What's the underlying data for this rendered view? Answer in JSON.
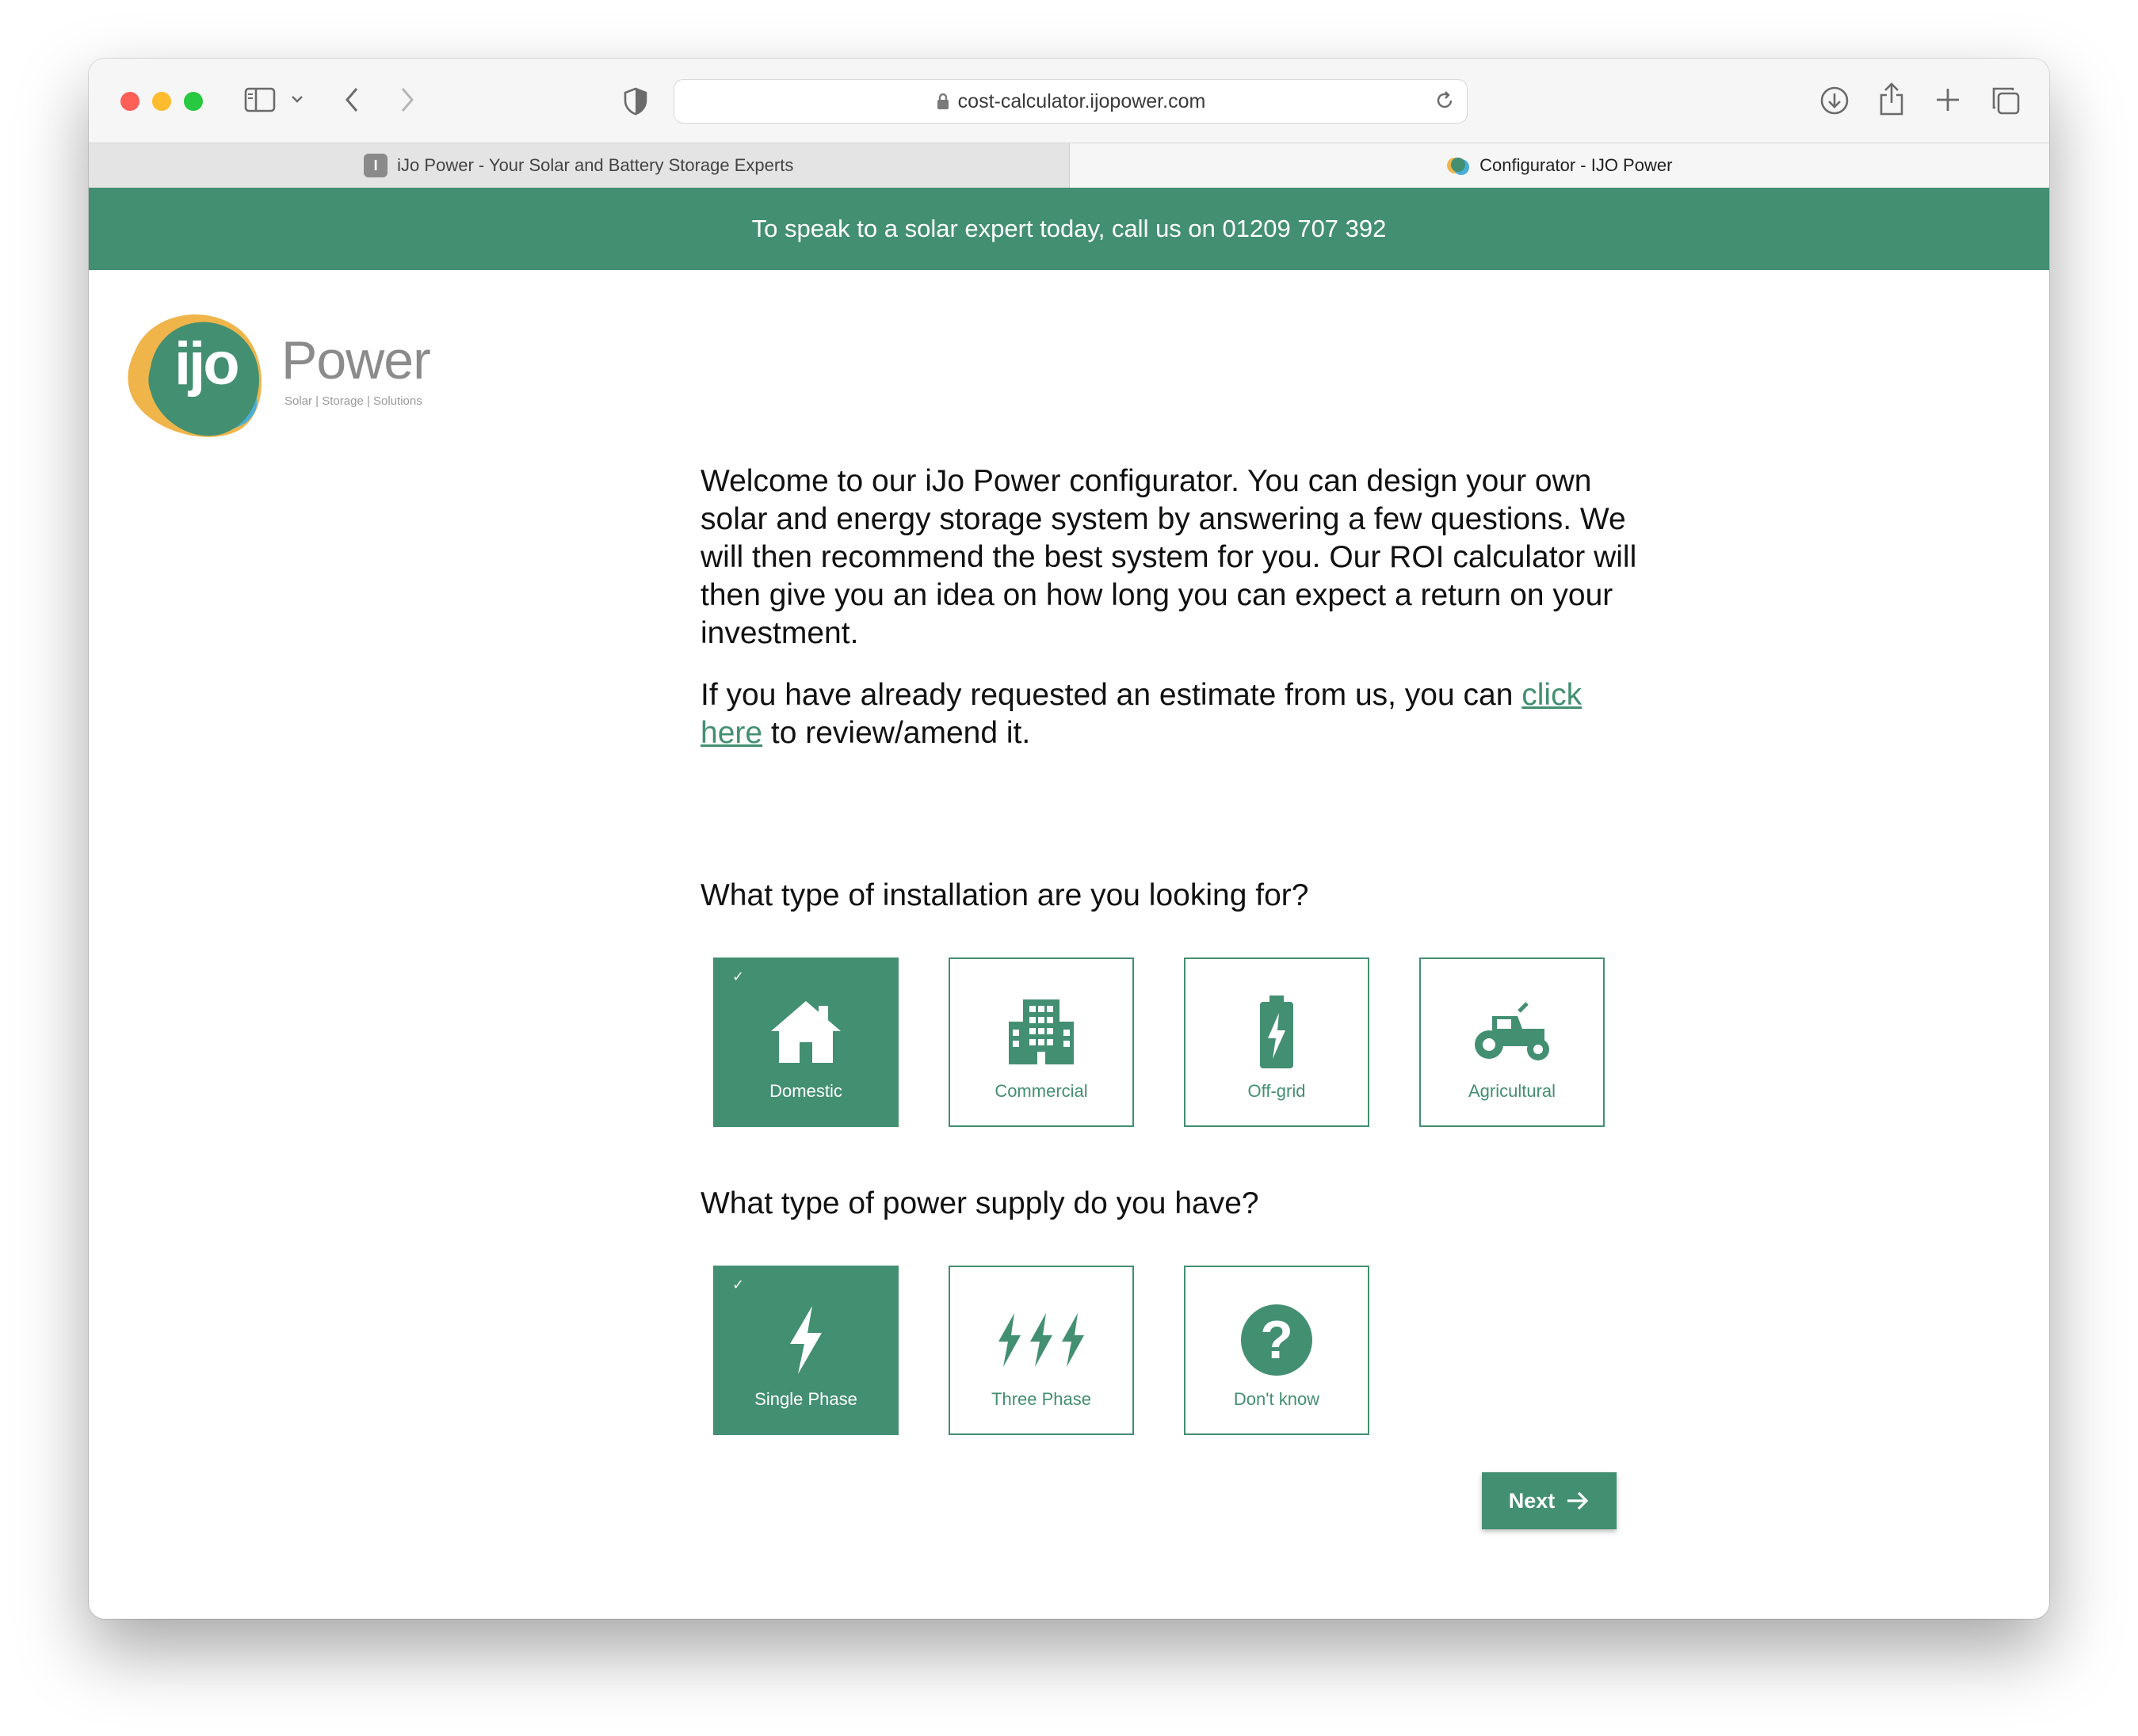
{
  "browser": {
    "url": "cost-calculator.ijopower.com",
    "tabs": [
      {
        "title": "iJo Power - Your Solar and Battery Storage Experts",
        "favicon_letter": "I"
      },
      {
        "title": "Configurator - IJO Power",
        "favicon_letter": "ijo"
      }
    ]
  },
  "banner": {
    "text": "To speak to a solar expert today, call us on 01209 707 392"
  },
  "logo": {
    "mark": "ijo",
    "wordmark": "Power",
    "tagline": "Solar | Storage | Solutions"
  },
  "intro": {
    "paragraph1": "Welcome to our iJo Power configurator. You can design your own solar and energy storage system by answering a few questions. We will then recommend the best system for you. Our ROI calculator will then give you an idea on how long you can expect a return on your investment.",
    "paragraph2_before": "If you have already requested an estimate from us, you can ",
    "paragraph2_link": "click here",
    "paragraph2_after": " to review/amend it."
  },
  "installation": {
    "question": "What type of installation are you looking for?",
    "options": [
      {
        "label": "Domestic",
        "icon": "house-icon",
        "selected": true
      },
      {
        "label": "Commercial",
        "icon": "building-icon",
        "selected": false
      },
      {
        "label": "Off-grid",
        "icon": "battery-bolt-icon",
        "selected": false
      },
      {
        "label": "Agricultural",
        "icon": "tractor-icon",
        "selected": false
      }
    ]
  },
  "power_supply": {
    "question": "What type of power supply do you have?",
    "options": [
      {
        "label": "Single Phase",
        "icon": "bolt-icon",
        "selected": true
      },
      {
        "label": "Three Phase",
        "icon": "triple-bolt-icon",
        "selected": false
      },
      {
        "label": "Don't know",
        "icon": "question-icon",
        "selected": false
      }
    ]
  },
  "check_mark": "✓",
  "next_button": {
    "label": "Next"
  },
  "colors": {
    "brand_green": "#438f71",
    "logo_orange": "#f0b54a",
    "logo_blue": "#4aaed8"
  }
}
